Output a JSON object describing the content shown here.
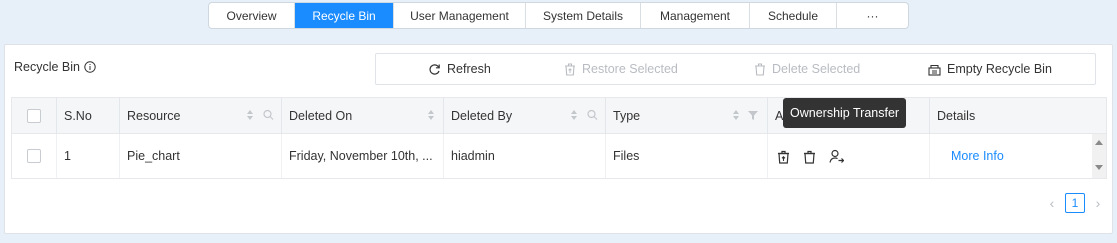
{
  "tabs": [
    {
      "label": "Overview",
      "active": false
    },
    {
      "label": "Recycle Bin",
      "active": true
    },
    {
      "label": "User Management",
      "active": false
    },
    {
      "label": "System Details",
      "active": false
    },
    {
      "label": "Management",
      "active": false
    },
    {
      "label": "Schedule",
      "active": false
    },
    {
      "label": "···",
      "active": false
    }
  ],
  "panel": {
    "title": "Recycle Bin",
    "info_icon": "info-circle-icon"
  },
  "toolbar": {
    "refresh": "Refresh",
    "restore": "Restore Selected",
    "delete": "Delete Selected",
    "empty": "Empty Recycle Bin"
  },
  "table": {
    "columns": [
      "S.No",
      "Resource",
      "Deleted On",
      "Deleted By",
      "Type",
      "Ac",
      "Details"
    ],
    "rows": [
      {
        "sno": "1",
        "resource": "Pie_chart",
        "deleted_on": "Friday, November 10th, ...",
        "deleted_by": "hiadmin",
        "type": "Files",
        "details": "More Info"
      }
    ]
  },
  "tooltip": "Ownership Transfer",
  "pagination": {
    "current_page": "1",
    "prev": "‹",
    "next": "›"
  },
  "colors": {
    "accent": "#1a8cff",
    "background": "#e7f0f8",
    "header_bg": "#f5f6f7",
    "tooltip_bg": "#333333"
  }
}
